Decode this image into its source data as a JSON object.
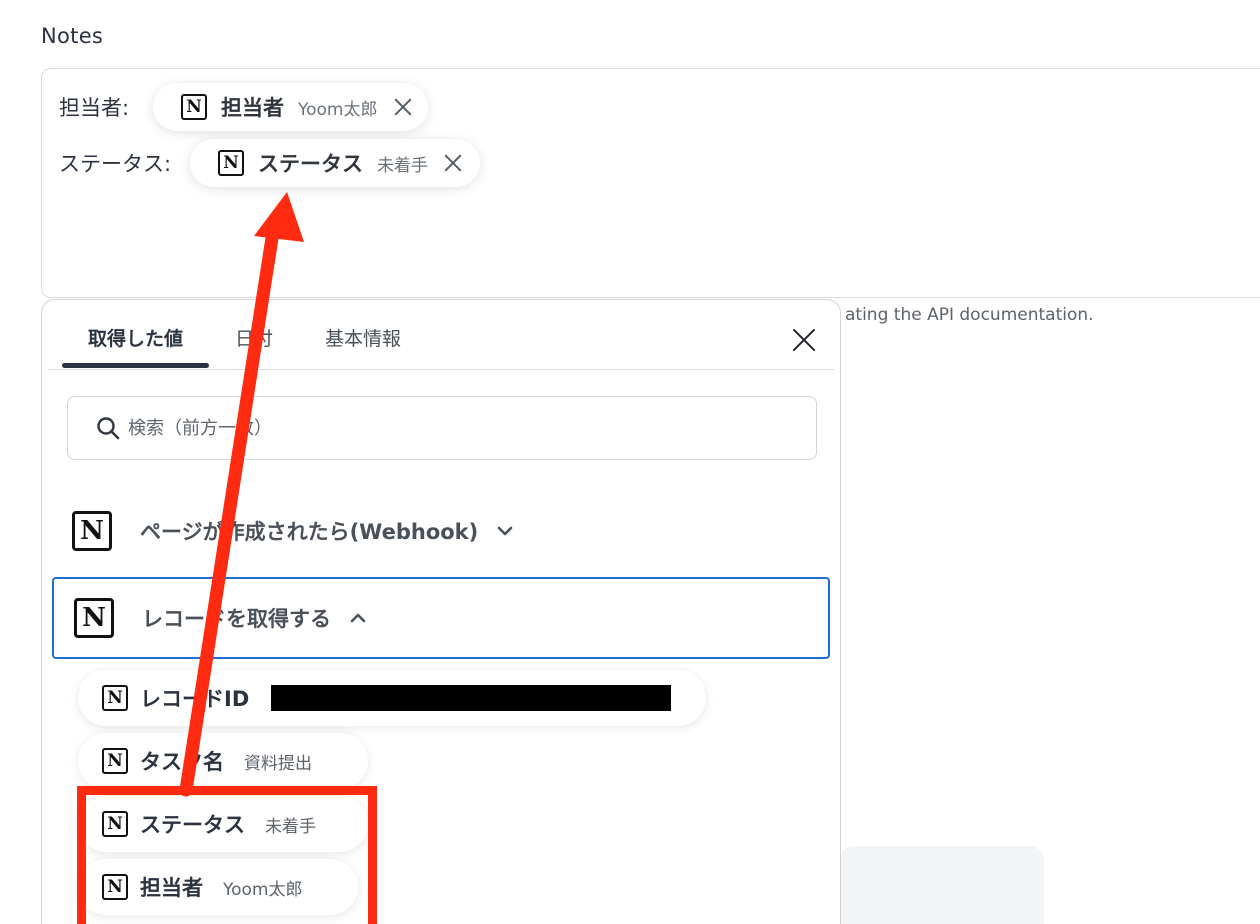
{
  "notes": {
    "label": "Notes",
    "rows": [
      {
        "label": "担当者:",
        "chip": {
          "title": "担当者",
          "value": "Yoom太郎"
        }
      },
      {
        "label": "ステータス:",
        "chip": {
          "title": "ステータス",
          "value": "未着手"
        }
      }
    ],
    "helper_text": "ating the API documentation."
  },
  "panel": {
    "tabs": [
      {
        "label": "取得した値",
        "active": true
      },
      {
        "label": "日付",
        "active": false
      },
      {
        "label": "基本情報",
        "active": false
      }
    ],
    "search": {
      "placeholder": "検索（前方一致）"
    },
    "groups": [
      {
        "label": "ページが作成されたら(Webhook)",
        "expanded": false
      },
      {
        "label": "レコードを取得する",
        "expanded": true
      }
    ],
    "items": [
      {
        "title": "レコードID",
        "value": ""
      },
      {
        "title": "タスク名",
        "value": "資料提出"
      },
      {
        "title": "ステータス",
        "value": "未着手"
      },
      {
        "title": "担当者",
        "value": "Yoom太郎"
      }
    ]
  },
  "icons": {
    "app_icon": "notion-icon",
    "app_letter": "N",
    "remove": "close-icon",
    "search": "search-icon"
  },
  "colors": {
    "annotation": "#ff2a10",
    "selected_border": "#1f6fd1"
  }
}
